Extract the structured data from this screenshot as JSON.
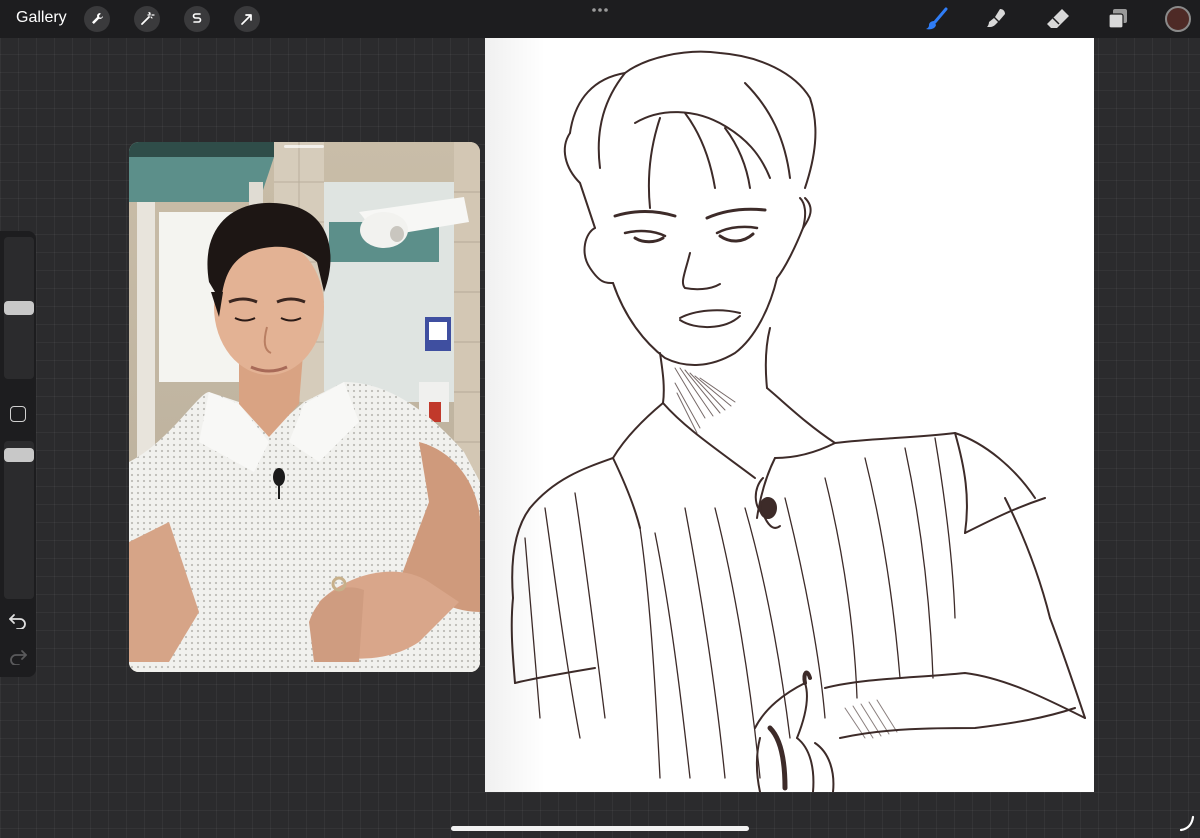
{
  "topbar": {
    "gallery_label": "Gallery",
    "left_tools": [
      {
        "icon": "wrench-icon"
      },
      {
        "icon": "magic-wand-icon"
      },
      {
        "icon": "selection-s-icon"
      },
      {
        "icon": "transform-arrow-icon"
      }
    ],
    "more_icon": "more-dots-icon",
    "right_tools": [
      {
        "icon": "brush-icon",
        "active": true
      },
      {
        "icon": "smudge-icon",
        "active": false
      },
      {
        "icon": "eraser-icon",
        "active": false
      },
      {
        "icon": "layers-icon",
        "active": false
      }
    ],
    "current_color": "#4e2a26",
    "active_tool_color": "#2f7df6"
  },
  "sidebar": {
    "brush_size_level": 0.5,
    "opacity_level": 0.05,
    "undo_icon": "undo-icon",
    "redo_icon": "redo-icon"
  },
  "reference": {
    "content": "reference-photo"
  },
  "canvas": {
    "background": "#ffffff",
    "stroke_color": "#3d2b29"
  }
}
